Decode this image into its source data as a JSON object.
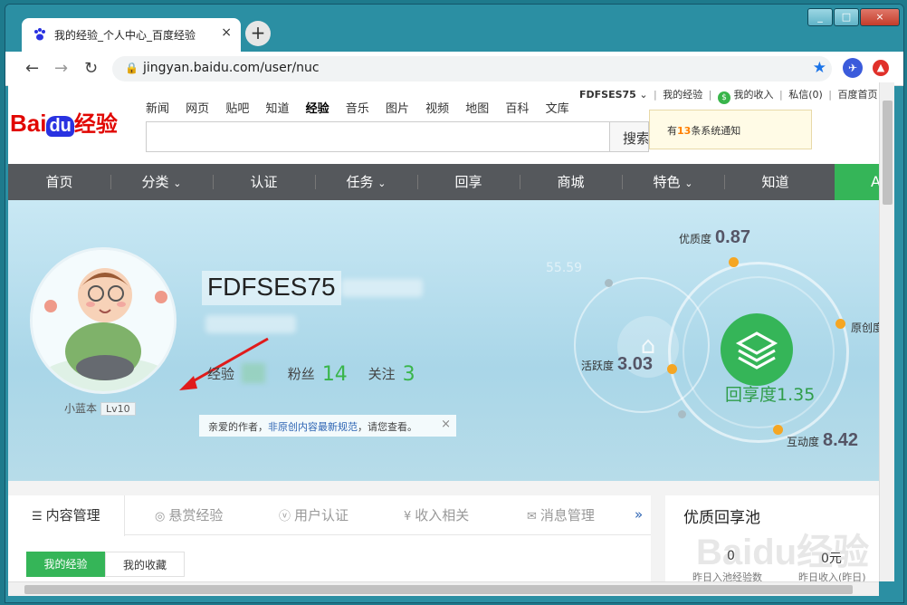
{
  "browser": {
    "tab_title": "我的经验_个人中心_百度经验",
    "tab_close": "×",
    "new_tab": "+",
    "url": "jingyan.baidu.com/user/nuc",
    "back": "←",
    "forward": "→",
    "reload": "↻",
    "star": "★",
    "window_controls": [
      "_",
      "□",
      "×"
    ]
  },
  "header": {
    "logo": {
      "bai": "Bai",
      "du": "du",
      "jingyan": "经验"
    },
    "nav": [
      "新闻",
      "网页",
      "贴吧",
      "知道",
      "经验",
      "音乐",
      "图片",
      "视频",
      "地图",
      "百科",
      "文库"
    ],
    "active_nav": "经验",
    "search_button": "搜索经验",
    "user": {
      "name": "FDFSES75",
      "my_exp": "我的经验",
      "my_income": "我的收入",
      "messages": "私信(0)",
      "home": "百度首页"
    },
    "notification": {
      "prefix": "有",
      "count": "13",
      "suffix": "条系统通知"
    }
  },
  "main_nav": [
    "首页",
    "分类",
    "认证",
    "任务",
    "回享",
    "商城",
    "特色",
    "知道"
  ],
  "main_nav_dropdown": [
    "分类",
    "任务",
    "特色"
  ],
  "main_nav_green": "A",
  "profile": {
    "display_name": "FDFSES75",
    "avatar_caption": "小蓝本",
    "level": "Lv10",
    "stats": {
      "exp_label": "经验",
      "fans_label": "粉丝",
      "fans": "14",
      "follow_label": "关注",
      "follow": "3"
    },
    "tip": {
      "before": "亲爱的作者，",
      "link": "非原创内容最新规范",
      "after": "，请您查看。",
      "close": "×"
    }
  },
  "metrics": {
    "faint": "55.59",
    "quality": {
      "label": "优质度",
      "value": "0.87"
    },
    "activity": {
      "label": "活跃度",
      "value": "3.03"
    },
    "original": {
      "label": "原创度"
    },
    "interaction": {
      "label": "互动度",
      "value": "8.42"
    },
    "huixiang": {
      "label": "回享度",
      "value": "1.35"
    }
  },
  "content_tabs": [
    {
      "label": "内容管理",
      "icon": "☰"
    },
    {
      "label": "悬赏经验",
      "icon": "◎"
    },
    {
      "label": "用户认证",
      "icon": "ⓥ"
    },
    {
      "label": "收入相关",
      "icon": "¥"
    },
    {
      "label": "消息管理",
      "icon": "✉"
    }
  ],
  "more_tabs": "»",
  "sub_tabs": [
    "我的经验",
    "我的收藏"
  ],
  "sidebar": {
    "title": "优质回享池",
    "value1": "0",
    "value2": "0元",
    "caption1": "昨日入池经验数",
    "caption2": "昨日收入(昨日)"
  },
  "watermark": "Baidu经验",
  "colors": {
    "accent_green": "#35b558",
    "baidu_red": "#e10601",
    "baidu_blue": "#2932e1",
    "metric_dot": "#f5a623"
  }
}
